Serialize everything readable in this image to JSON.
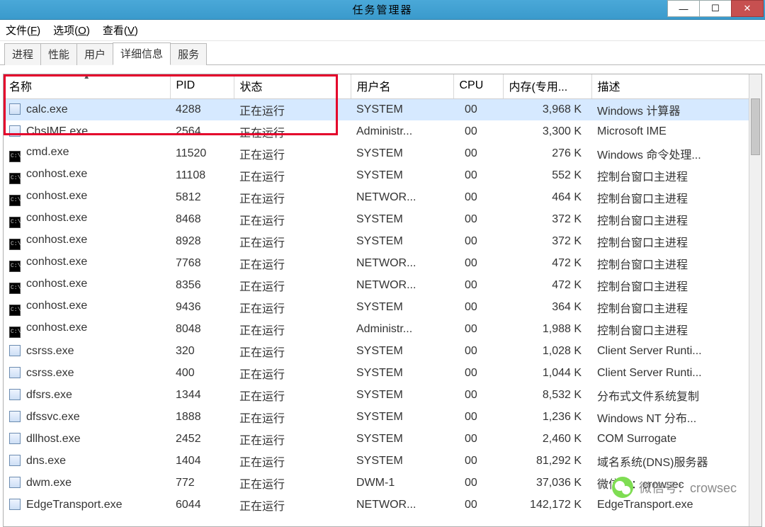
{
  "window": {
    "title": "任务管理器"
  },
  "menu": {
    "file": {
      "text": "文件(",
      "ul": "F",
      "suffix": ")"
    },
    "options": {
      "text": "选项(",
      "ul": "O",
      "suffix": ")"
    },
    "view": {
      "text": "查看(",
      "ul": "V",
      "suffix": ")"
    }
  },
  "tabs": {
    "processes": "进程",
    "performance": "性能",
    "users": "用户",
    "details": "详细信息",
    "services": "服务"
  },
  "columns": {
    "name": "名称",
    "pid": "PID",
    "status": "状态",
    "user": "用户名",
    "cpu": "CPU",
    "mem": "内存(专用...",
    "desc": "描述"
  },
  "rows": [
    {
      "icon": "app",
      "name": "calc.exe",
      "pid": "4288",
      "status": "正在运行",
      "user": "SYSTEM",
      "cpu": "00",
      "mem": "3,968 K",
      "desc": "Windows 计算器",
      "selected": true
    },
    {
      "icon": "app",
      "name": "ChsIME.exe",
      "pid": "2564",
      "status": "正在运行",
      "user": "Administr...",
      "cpu": "00",
      "mem": "3,300 K",
      "desc": "Microsoft IME"
    },
    {
      "icon": "cmd",
      "name": "cmd.exe",
      "pid": "11520",
      "status": "正在运行",
      "user": "SYSTEM",
      "cpu": "00",
      "mem": "276 K",
      "desc": "Windows 命令处理..."
    },
    {
      "icon": "cmd",
      "name": "conhost.exe",
      "pid": "11108",
      "status": "正在运行",
      "user": "SYSTEM",
      "cpu": "00",
      "mem": "552 K",
      "desc": "控制台窗口主进程"
    },
    {
      "icon": "cmd",
      "name": "conhost.exe",
      "pid": "5812",
      "status": "正在运行",
      "user": "NETWOR...",
      "cpu": "00",
      "mem": "464 K",
      "desc": "控制台窗口主进程"
    },
    {
      "icon": "cmd",
      "name": "conhost.exe",
      "pid": "8468",
      "status": "正在运行",
      "user": "SYSTEM",
      "cpu": "00",
      "mem": "372 K",
      "desc": "控制台窗口主进程"
    },
    {
      "icon": "cmd",
      "name": "conhost.exe",
      "pid": "8928",
      "status": "正在运行",
      "user": "SYSTEM",
      "cpu": "00",
      "mem": "372 K",
      "desc": "控制台窗口主进程"
    },
    {
      "icon": "cmd",
      "name": "conhost.exe",
      "pid": "7768",
      "status": "正在运行",
      "user": "NETWOR...",
      "cpu": "00",
      "mem": "472 K",
      "desc": "控制台窗口主进程"
    },
    {
      "icon": "cmd",
      "name": "conhost.exe",
      "pid": "8356",
      "status": "正在运行",
      "user": "NETWOR...",
      "cpu": "00",
      "mem": "472 K",
      "desc": "控制台窗口主进程"
    },
    {
      "icon": "cmd",
      "name": "conhost.exe",
      "pid": "9436",
      "status": "正在运行",
      "user": "SYSTEM",
      "cpu": "00",
      "mem": "364 K",
      "desc": "控制台窗口主进程"
    },
    {
      "icon": "cmd",
      "name": "conhost.exe",
      "pid": "8048",
      "status": "正在运行",
      "user": "Administr...",
      "cpu": "00",
      "mem": "1,988 K",
      "desc": "控制台窗口主进程"
    },
    {
      "icon": "app",
      "name": "csrss.exe",
      "pid": "320",
      "status": "正在运行",
      "user": "SYSTEM",
      "cpu": "00",
      "mem": "1,028 K",
      "desc": "Client Server Runti..."
    },
    {
      "icon": "app",
      "name": "csrss.exe",
      "pid": "400",
      "status": "正在运行",
      "user": "SYSTEM",
      "cpu": "00",
      "mem": "1,044 K",
      "desc": "Client Server Runti..."
    },
    {
      "icon": "app",
      "name": "dfsrs.exe",
      "pid": "1344",
      "status": "正在运行",
      "user": "SYSTEM",
      "cpu": "00",
      "mem": "8,532 K",
      "desc": "分布式文件系统复制"
    },
    {
      "icon": "app",
      "name": "dfssvc.exe",
      "pid": "1888",
      "status": "正在运行",
      "user": "SYSTEM",
      "cpu": "00",
      "mem": "1,236 K",
      "desc": "Windows NT 分布..."
    },
    {
      "icon": "app",
      "name": "dllhost.exe",
      "pid": "2452",
      "status": "正在运行",
      "user": "SYSTEM",
      "cpu": "00",
      "mem": "2,460 K",
      "desc": "COM Surrogate"
    },
    {
      "icon": "app",
      "name": "dns.exe",
      "pid": "1404",
      "status": "正在运行",
      "user": "SYSTEM",
      "cpu": "00",
      "mem": "81,292 K",
      "desc": "域名系统(DNS)服务器"
    },
    {
      "icon": "app",
      "name": "dwm.exe",
      "pid": "772",
      "status": "正在运行",
      "user": "DWM-1",
      "cpu": "00",
      "mem": "37,036 K",
      "desc": "微信号：crowsec"
    },
    {
      "icon": "app",
      "name": "EdgeTransport.exe",
      "pid": "6044",
      "status": "正在运行",
      "user": "NETWOR...",
      "cpu": "00",
      "mem": "142,172 K",
      "desc": "EdgeTransport.exe"
    }
  ],
  "watermark": {
    "text": "微信号：crowsec"
  }
}
